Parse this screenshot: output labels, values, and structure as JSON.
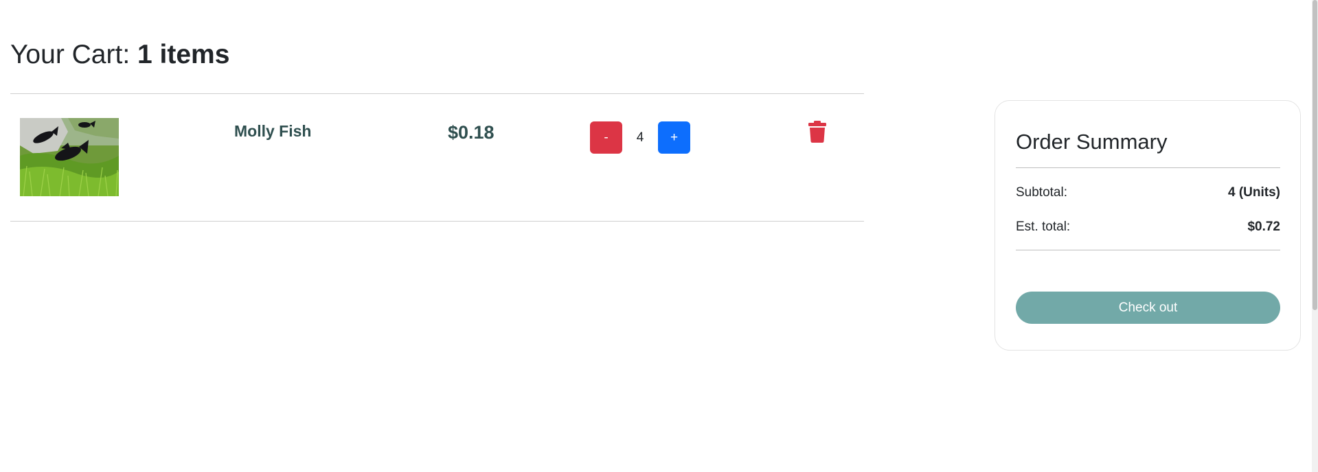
{
  "cart": {
    "title_prefix": "Your Cart: ",
    "item_count": "1 items",
    "items": [
      {
        "name": "Molly Fish",
        "price": "$0.18",
        "quantity": "4",
        "decrement_label": "-",
        "increment_label": "+",
        "image_icon": "fish-photo",
        "delete_icon": "trash-icon"
      }
    ]
  },
  "summary": {
    "title": "Order Summary",
    "subtotal_label": "Subtotal:",
    "subtotal_value": "4 (Units)",
    "total_label": "Est. total:",
    "total_value": "$0.72",
    "checkout_label": "Check out"
  },
  "colors": {
    "decrement": "#dc3545",
    "increment": "#0d6efd",
    "trash": "#dc3545",
    "checkout": "#72a9a8",
    "product_text": "#2f4f4f"
  }
}
